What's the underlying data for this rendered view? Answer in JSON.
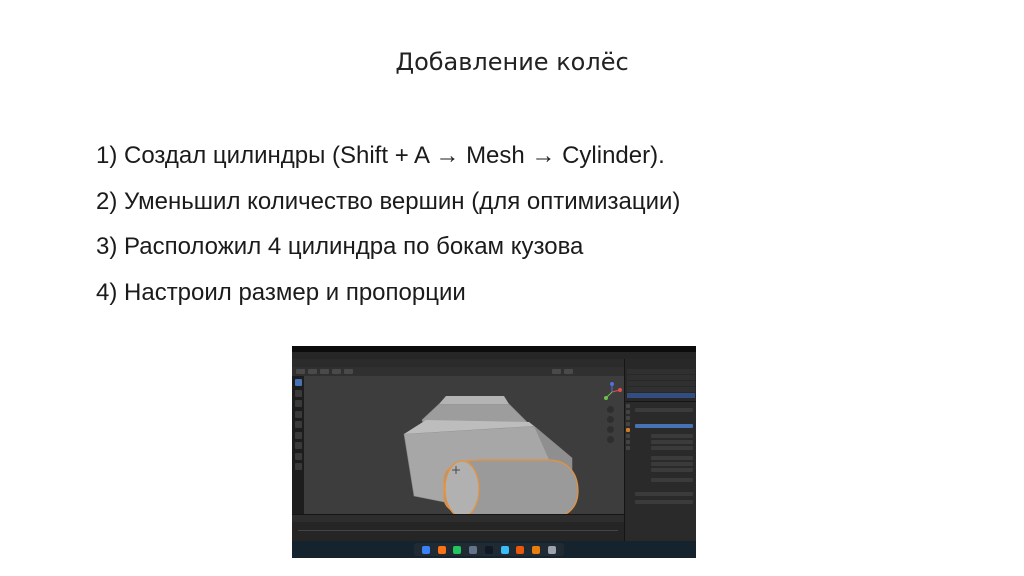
{
  "slide": {
    "title": "Добавление колёс",
    "steps": [
      "1) Создал цилиндры (Shift + A → Mesh → Cylinder).",
      "2) Уменьшил количество вершин (для оптимизации)",
      "3) Расположил 4 цилиндра по бокам кузова",
      "4) Настроил размер и пропорции"
    ]
  },
  "screenshot": {
    "app": "Blender",
    "viewport_background": "#3d3d3d",
    "selection_color": "#e8913a",
    "accent": "#4772b3",
    "dock_apps": [
      "finder-icon",
      "launchpad-icon",
      "chrome-icon",
      "settings-icon",
      "terminal-icon",
      "telegram-icon",
      "firefox-icon",
      "blender-icon",
      "trash-icon"
    ]
  }
}
